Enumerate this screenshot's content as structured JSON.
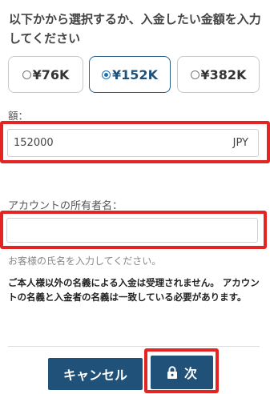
{
  "prompt": "以下かから選択するか、入金したい金額を入力してください",
  "amount_options": [
    {
      "label": "¥76K",
      "selected": false
    },
    {
      "label": "¥152K",
      "selected": true
    },
    {
      "label": "¥382K",
      "selected": false
    }
  ],
  "amount_field": {
    "label": "額：",
    "value": "152000",
    "currency": "JPY"
  },
  "holder_field": {
    "label": "アカウントの所有者名：",
    "value": "",
    "help": "お客様の氏名を入力してください。"
  },
  "notice": "ご本人様以外の名義による入金は受理されません。 アカウントの名義と入金者の名義は一致している必要があります。",
  "buttons": {
    "cancel": "キャンセル",
    "next": "次"
  },
  "colors": {
    "primary": "#1f5179",
    "highlight": "#e42323",
    "radio_selected": "#1f6fb2"
  }
}
